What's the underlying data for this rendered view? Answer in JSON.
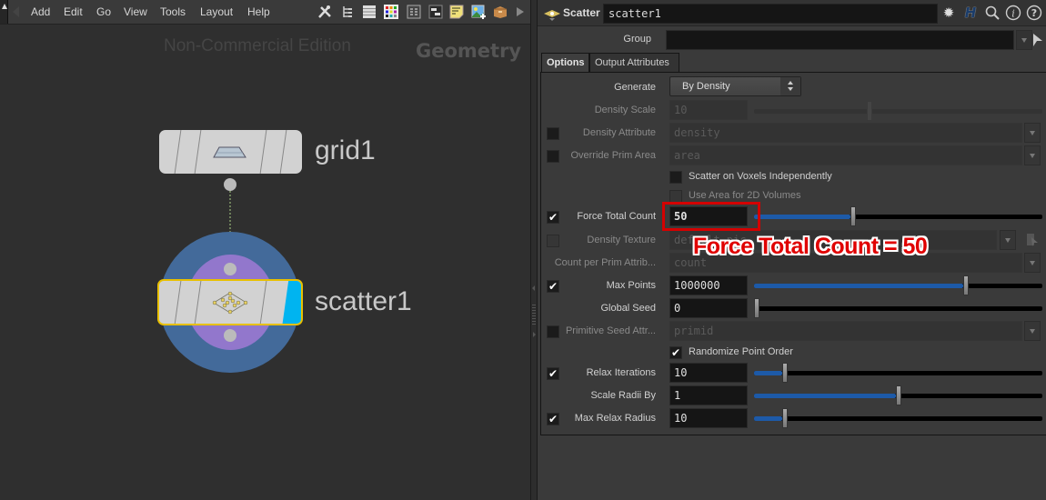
{
  "network": {
    "menu": [
      "Add",
      "Edit",
      "Go",
      "View",
      "Tools",
      "Layout",
      "Help"
    ],
    "toolbar_icons": [
      "tools-icon",
      "tree-icon",
      "list-icon",
      "color-palette-icon",
      "grid-icon",
      "network-box-icon",
      "sticky-note-icon",
      "add-image-icon",
      "subnet-box-icon",
      "more-arrow-icon"
    ],
    "watermark": "Non-Commercial Edition",
    "context": "Geometry",
    "nodes": [
      {
        "name": "grid1",
        "type": "grid"
      },
      {
        "name": "scatter1",
        "type": "scatter",
        "selected": true,
        "display_flag": true
      }
    ]
  },
  "params": {
    "op_type": "Scatter",
    "node_name": "scatter1",
    "header_icons": [
      "gear-icon",
      "houdini-help-icon",
      "search-icon",
      "info-icon",
      "help-icon"
    ],
    "group": {
      "label": "Group",
      "value": ""
    },
    "tabs": [
      {
        "label": "Options",
        "active": true
      },
      {
        "label": "Output Attributes",
        "active": false
      }
    ],
    "generate": {
      "label": "Generate",
      "value": "By Density"
    },
    "density_scale": {
      "label": "Density Scale",
      "value": "10",
      "enabled": false,
      "slider_fraction": 0.4
    },
    "density_attribute": {
      "label": "Density Attribute",
      "value": "density",
      "checked": false,
      "enabled": false
    },
    "override_prim_area": {
      "label": "Override Prim Area",
      "value": "area",
      "checked": false,
      "enabled": false
    },
    "scatter_on_voxels": {
      "label": "Scatter on Voxels Independently",
      "checked": false
    },
    "use_area_2d": {
      "label": "Use Area for 2D Volumes",
      "checked": false,
      "enabled": false
    },
    "force_total_count": {
      "label": "Force Total Count",
      "value": "50",
      "checked": true,
      "slider_fraction": 0.34
    },
    "density_texture": {
      "label": "Density Texture",
      "value": "default.pic",
      "enabled": false
    },
    "count_per_prim": {
      "label": "Count per Prim Attrib...",
      "value": "count",
      "enabled": false
    },
    "max_points": {
      "label": "Max Points",
      "value": "1000000",
      "checked": true,
      "slider_fraction": 0.74
    },
    "global_seed": {
      "label": "Global Seed",
      "value": "0",
      "slider_fraction": 0.0
    },
    "primitive_seed": {
      "label": "Primitive Seed Attr...",
      "value": "primid",
      "checked": false,
      "enabled": false
    },
    "randomize_order": {
      "label": "Randomize Point Order",
      "checked": true
    },
    "relax_iterations": {
      "label": "Relax Iterations",
      "value": "10",
      "checked": true,
      "slider_fraction": 0.1
    },
    "scale_radii": {
      "label": "Scale Radii By",
      "value": "1",
      "slider_fraction": 0.5
    },
    "max_relax_radius": {
      "label": "Max Relax Radius",
      "value": "10",
      "checked": true,
      "slider_fraction": 0.1
    }
  },
  "annotation": {
    "text": "Force Total Count = 50",
    "color": "#e00000"
  }
}
